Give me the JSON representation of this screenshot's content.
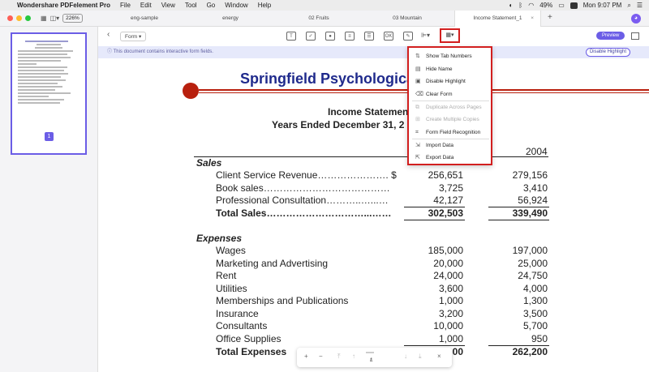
{
  "menubar": {
    "app": "Wondershare PDFelement Pro",
    "items": [
      "File",
      "Edit",
      "View",
      "Tool",
      "Go",
      "Window",
      "Help"
    ],
    "battery": "49%",
    "clock": "Mon 9:07 PM"
  },
  "tabs": {
    "zoom": "226%",
    "items": [
      "eng-sample",
      "energy",
      "02 Fruits",
      "03 Mountain",
      "Income Statement_1"
    ],
    "active_close": "×",
    "plus": "+"
  },
  "sidebar": {
    "page_number": "1"
  },
  "toolbar": {
    "form_label": "Form",
    "preview_label": "Preview"
  },
  "notice": {
    "text": "This document contains interactive form fields.",
    "button": "Disable Highlight"
  },
  "document": {
    "title": "Springfield Psychologica",
    "subtitle1": "Income Statemen",
    "subtitle2": "Years Ended December 31, 2",
    "col_year": "2004",
    "sales_header": "Sales",
    "sales_rows": [
      {
        "label": "Client Service Revenue…………………. $",
        "a": "256,651",
        "b": "279,156"
      },
      {
        "label": "Book sales…………………………………",
        "a": "3,725",
        "b": "3,410"
      },
      {
        "label": "Professional Consultation………..…...…",
        "a": "42,127",
        "b": "56,924"
      }
    ],
    "total_sales": {
      "label": "Total Sales…………………………...……",
      "a": "302,503",
      "b": "339,490"
    },
    "expenses_header": "Expenses",
    "expense_rows": [
      {
        "label": "Wages",
        "a": "185,000",
        "b": "197,000"
      },
      {
        "label": "Marketing and Advertising",
        "a": "20,000",
        "b": "25,000"
      },
      {
        "label": "Rent",
        "a": "24,000",
        "b": "24,750"
      },
      {
        "label": "Utilities",
        "a": "3,600",
        "b": "4,000"
      },
      {
        "label": "Memberships and Publications",
        "a": "1,000",
        "b": "1,300"
      },
      {
        "label": "Insurance",
        "a": "3,200",
        "b": "3,500"
      },
      {
        "label": "Consultants",
        "a": "10,000",
        "b": "5,700"
      },
      {
        "label": "Office Supplies",
        "a": "1,000",
        "b": "950"
      }
    ],
    "total_expenses": {
      "label": "Total Expenses",
      "a": "…00",
      "b": "262,200"
    }
  },
  "bottombar": {
    "plus": "+",
    "minus": "−",
    "page": "1",
    "sep": "/",
    "total": "1",
    "close": "×"
  },
  "dropdown": {
    "items": [
      {
        "label": "Show Tab Numbers",
        "icon": "tab-numbers-icon",
        "glyph": "⇅",
        "disabled": false
      },
      {
        "label": "Hide Name",
        "icon": "hide-name-icon",
        "glyph": "▤",
        "disabled": false
      },
      {
        "label": "Disable Highlight",
        "icon": "highlight-icon",
        "glyph": "▣",
        "disabled": false
      },
      {
        "label": "Clear Form",
        "icon": "clear-form-icon",
        "glyph": "⌫",
        "disabled": false
      },
      {
        "label": "Duplicate Across Pages",
        "icon": "duplicate-icon",
        "glyph": "⧉",
        "disabled": true
      },
      {
        "label": "Create Multiple Copies",
        "icon": "copies-icon",
        "glyph": "⊞",
        "disabled": true
      },
      {
        "label": "Form Field Recognition",
        "icon": "recognition-icon",
        "glyph": "⌗",
        "disabled": false
      },
      {
        "label": "Import Data",
        "icon": "import-icon",
        "glyph": "⇲",
        "disabled": false
      },
      {
        "label": "Export Data",
        "icon": "export-icon",
        "glyph": "⇱",
        "disabled": false
      }
    ]
  },
  "colors": {
    "accent": "#6b5de6",
    "highlight_box": "#d21f1f",
    "title_blue": "#1f2a8c",
    "brand_red": "#b8200e"
  }
}
